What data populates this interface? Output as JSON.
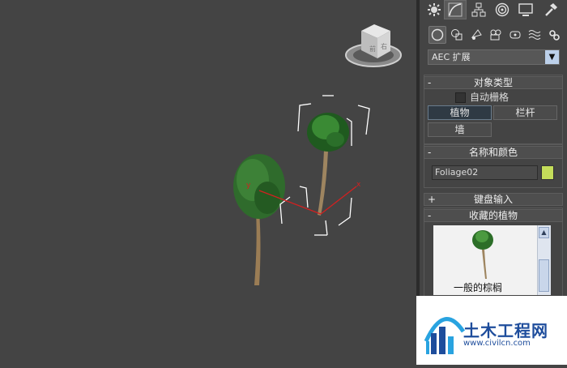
{
  "dropdown": {
    "value": "AEC 扩展"
  },
  "rollouts": {
    "object_type": {
      "sign": "-",
      "title": "对象类型"
    },
    "name_color": {
      "sign": "-",
      "title": "名称和颜色"
    },
    "keyboard": {
      "sign": "+",
      "title": "键盘输入"
    },
    "favorites": {
      "sign": "-",
      "title": "收藏的植物"
    }
  },
  "object_type": {
    "autogrid_label": "自动栅格",
    "buttons": [
      "植物",
      "栏杆",
      "墙"
    ]
  },
  "name_color": {
    "name_value": "Foliage02",
    "color": "#c4dd5a"
  },
  "favorites": {
    "selected_label": "一般的棕榈"
  },
  "watermark": {
    "name": "土木工程网",
    "url": "www.civilcn.com"
  },
  "icons": {
    "tabs": [
      "sun-gear-icon",
      "modify-curve-icon",
      "hierarchy-icon",
      "motion-icon",
      "display-icon",
      "utilities-hammer-icon"
    ],
    "create": [
      "geometry-sphere-icon",
      "shapes-icon",
      "lights-icon",
      "cameras-icon",
      "helpers-icon",
      "spacewarps-icon",
      "systems-icon"
    ]
  }
}
